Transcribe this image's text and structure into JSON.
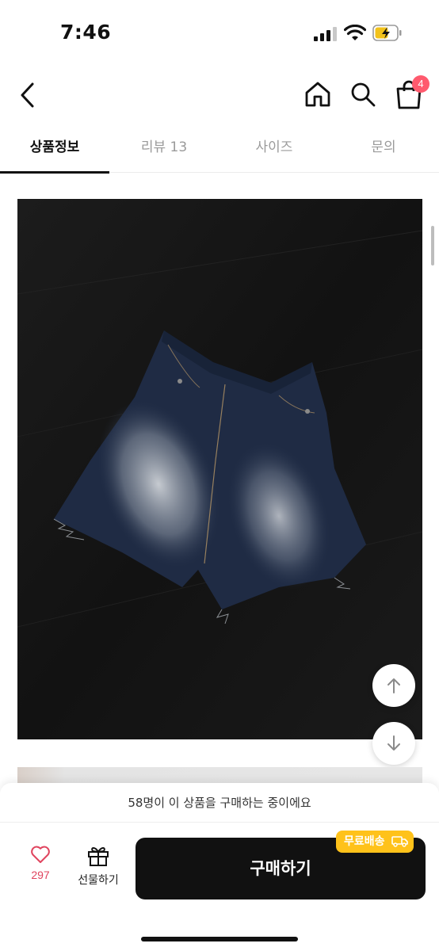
{
  "status_bar": {
    "time": "7:46",
    "icons": [
      "cellular-signal-icon",
      "wifi-icon",
      "battery-charging-icon"
    ]
  },
  "nav": {
    "back_icon": "chevron-left-icon",
    "home_icon": "home-icon",
    "search_icon": "search-icon",
    "cart_icon": "shopping-bag-icon",
    "cart_count": "4"
  },
  "tabs": [
    {
      "label": "상품정보",
      "active": true
    },
    {
      "label": "리뷰 13",
      "active": false
    },
    {
      "label": "사이즈",
      "active": false
    },
    {
      "label": "문의",
      "active": false
    }
  ],
  "scroll_buttons": {
    "up_icon": "arrow-up-icon",
    "down_icon": "arrow-down-icon"
  },
  "bottom_bar": {
    "buyers_notice": "58명이 이 상품을 구매하는 중이에요",
    "like_icon": "heart-icon",
    "like_count": "297",
    "gift_icon": "gift-icon",
    "gift_label": "선물하기",
    "buy_label": "구매하기",
    "free_shipping_label": "무료배송",
    "free_shipping_icon": "truck-icon"
  },
  "colors": {
    "accent_pink": "#e0445e",
    "badge_red": "#ff5a6e",
    "shipping_yellow": "#ffc21a",
    "buy_button": "#111111"
  }
}
